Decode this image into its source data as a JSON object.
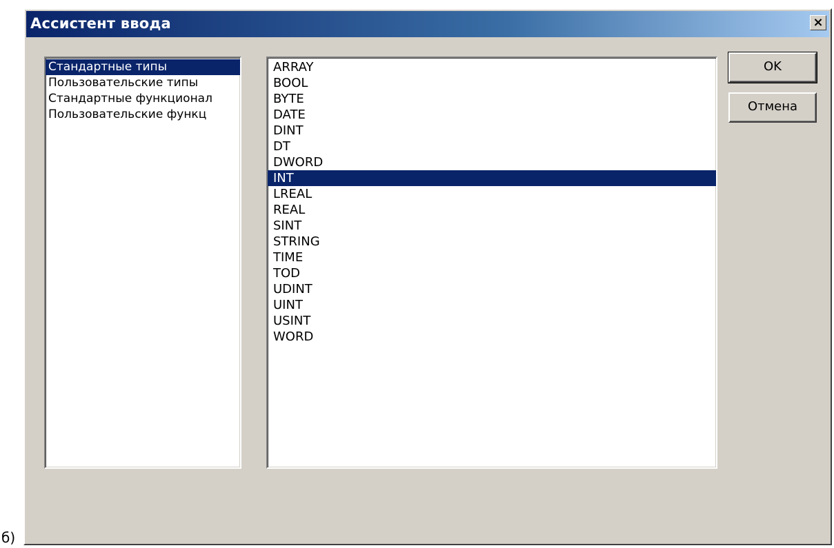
{
  "caption": "б)",
  "window": {
    "title": "Ассистент ввода",
    "close_label": "×"
  },
  "categories": {
    "items": [
      {
        "label": "Стандартные типы",
        "selected": true
      },
      {
        "label": "Пользовательские типы",
        "selected": false
      },
      {
        "label": "Стандартные функционал",
        "selected": false
      },
      {
        "label": "Пользовательские функц",
        "selected": false
      }
    ]
  },
  "types": {
    "items": [
      {
        "label": "ARRAY",
        "selected": false
      },
      {
        "label": "BOOL",
        "selected": false
      },
      {
        "label": "BYTE",
        "selected": false
      },
      {
        "label": "DATE",
        "selected": false
      },
      {
        "label": "DINT",
        "selected": false
      },
      {
        "label": "DT",
        "selected": false
      },
      {
        "label": "DWORD",
        "selected": false
      },
      {
        "label": "INT",
        "selected": true
      },
      {
        "label": "LREAL",
        "selected": false
      },
      {
        "label": "REAL",
        "selected": false
      },
      {
        "label": "SINT",
        "selected": false
      },
      {
        "label": "STRING",
        "selected": false
      },
      {
        "label": "TIME",
        "selected": false
      },
      {
        "label": "TOD",
        "selected": false
      },
      {
        "label": "UDINT",
        "selected": false
      },
      {
        "label": "UINT",
        "selected": false
      },
      {
        "label": "USINT",
        "selected": false
      },
      {
        "label": "WORD",
        "selected": false
      }
    ]
  },
  "buttons": {
    "ok_label": "OK",
    "cancel_label": "Отмена"
  },
  "colors": {
    "title_bar_active": "#0a246a",
    "selection": "#0a246a",
    "dialog_face": "#d4d0c8"
  }
}
